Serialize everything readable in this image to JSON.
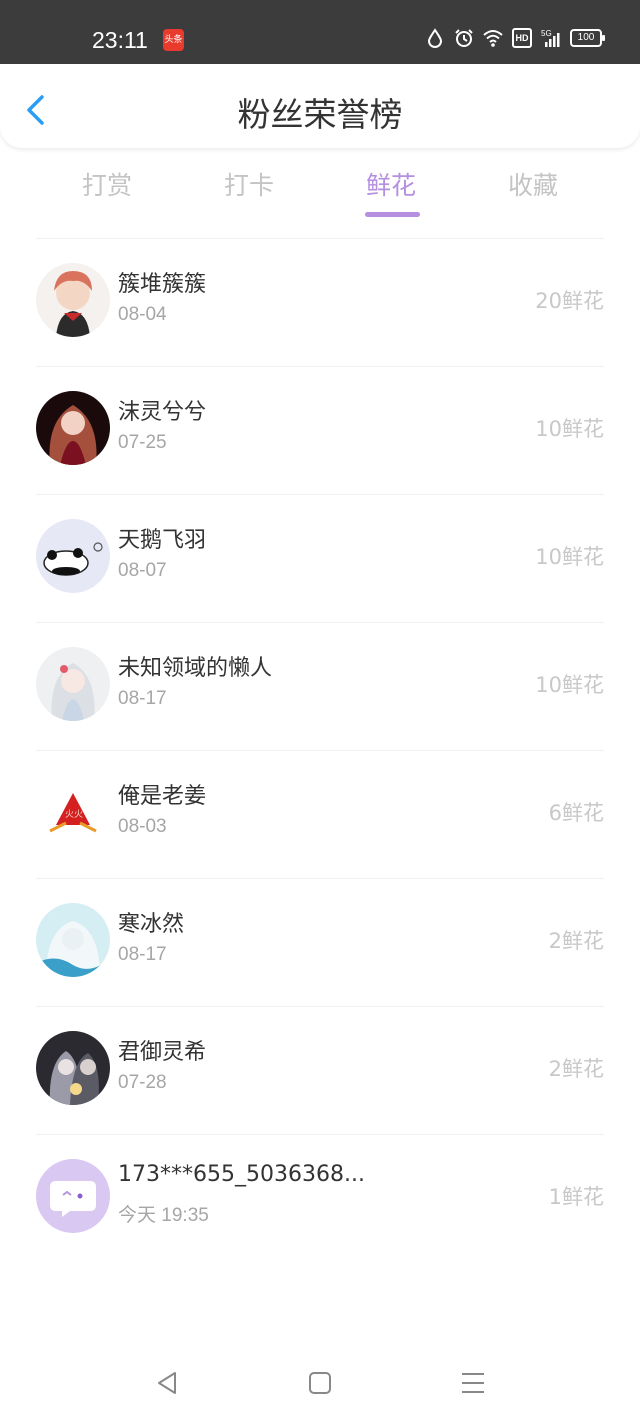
{
  "status": {
    "time": "23:11",
    "news_badge": "头条",
    "hd": "HD",
    "battery": "100",
    "icons": [
      "water-drop-icon",
      "alarm-icon",
      "wifi-icon",
      "hd-icon",
      "5g-signal-icon",
      "battery-icon"
    ]
  },
  "header": {
    "title": "粉丝荣誉榜",
    "back_icon": "chevron-left-icon"
  },
  "tabs": [
    {
      "label": "打赏",
      "active": false
    },
    {
      "label": "打卡",
      "active": false
    },
    {
      "label": "鲜花",
      "active": true
    },
    {
      "label": "收藏",
      "active": false
    }
  ],
  "accent_color": "#b58fe0",
  "fans": [
    {
      "name": "簇堆簇簇",
      "date": "08-04",
      "count": "20鲜花"
    },
    {
      "name": "沫灵兮兮",
      "date": "07-25",
      "count": "10鲜花"
    },
    {
      "name": "天鹅飞羽",
      "date": "08-07",
      "count": "10鲜花"
    },
    {
      "name": "未知领域的懒人",
      "date": "08-17",
      "count": "10鲜花"
    },
    {
      "name": "俺是老姜",
      "date": "08-03",
      "count": "6鲜花"
    },
    {
      "name": "寒冰然",
      "date": "08-17",
      "count": "2鲜花"
    },
    {
      "name": "君御灵希",
      "date": "07-28",
      "count": "2鲜花"
    },
    {
      "name": "173***655_5036368...",
      "date": "今天 19:35",
      "count": "1鲜花"
    }
  ],
  "navbar": {
    "icons": [
      "back-triangle-icon",
      "home-square-icon",
      "menu-lines-icon"
    ]
  }
}
